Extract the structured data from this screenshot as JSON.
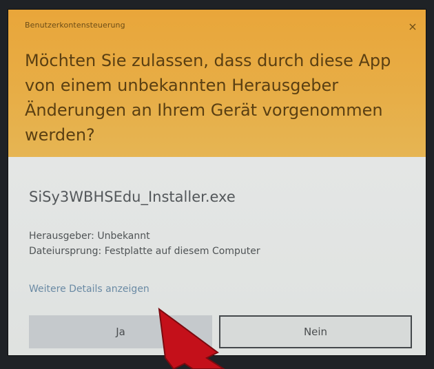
{
  "dialog": {
    "title": "Benutzerkontensteuerung",
    "close_icon": "×",
    "question": "Möchten Sie zulassen, dass durch diese App von einem unbekannten Herausgeber Änderungen an Ihrem Gerät vorgenommen werden?",
    "filename": "SiSy3WBHSEdu_Installer.exe",
    "publisher": "Herausgeber: Unbekannt",
    "origin": "Dateiursprung: Festplatte auf diesem Computer",
    "details_link": "Weitere Details anzeigen",
    "yes_label": "Ja",
    "no_label": "Nein"
  },
  "colors": {
    "header": "#e9a63a",
    "body": "#e4e6e5",
    "arrow": "#c4101a"
  }
}
